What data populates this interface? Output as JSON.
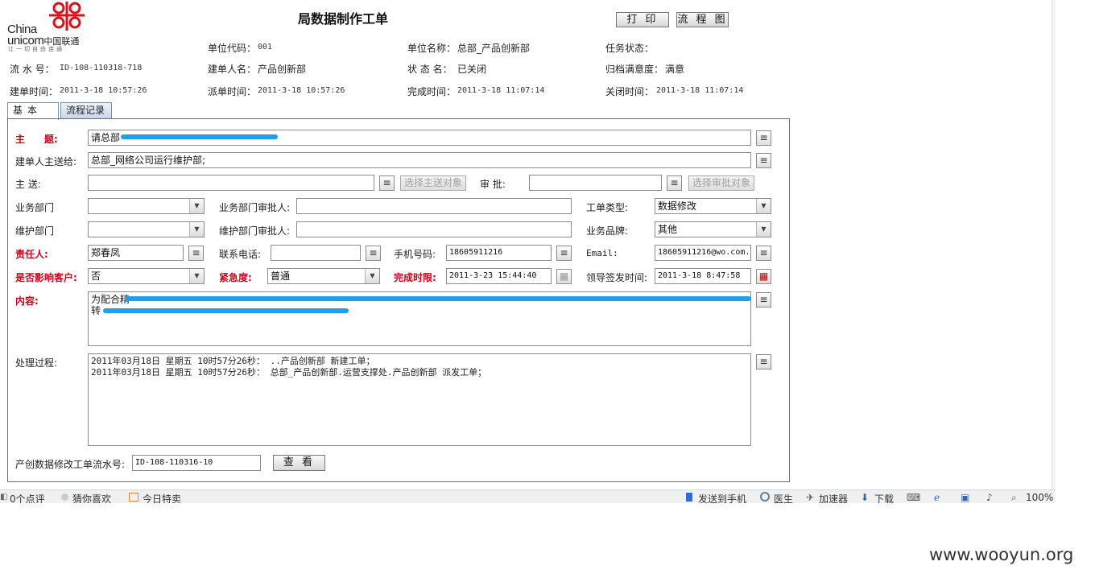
{
  "logo": {
    "en_line1": "China",
    "en_line2": "unicom",
    "cn_name": "中国联通",
    "slogan": "让一切自由连通"
  },
  "title": "局数据制作工单",
  "buttons": {
    "print": "打 印",
    "flowchart": "流 程 图",
    "view": "查 看",
    "select_cc": "选择主送对象",
    "select_approve": "选择审批对象"
  },
  "header": {
    "unit_code_label": "单位代码：",
    "unit_code": "001",
    "unit_name_label": "单位名称：",
    "unit_name": "总部_产品创新部",
    "task_status_label": "任务状态：",
    "task_status": "",
    "serial_label": "流 水 号：",
    "serial": "ID-108-110318-718",
    "creator_label": "建单人名：",
    "creator": "产品创新部",
    "status_label": "状 态 名：",
    "status": "已关闭",
    "satisfaction_label": "归档满意度：",
    "satisfaction": "满意",
    "created_label": "建单时间：",
    "created": "2011-3-18 10:57:26",
    "dispatched_label": "派单时间：",
    "dispatched": "2011-3-18 10:57:26",
    "completed_label": "完成时间：",
    "completed": "2011-3-18 11:07:14",
    "closed_label": "关闭时间：",
    "closed": "2011-3-18 11:07:14"
  },
  "tabs": [
    {
      "label": "基本"
    },
    {
      "label": "流程记录"
    }
  ],
  "form": {
    "subject_label": "主　　题:",
    "subject": "请总部",
    "main_recipient_label": "建单人主送给:",
    "main_recipient": "总部_网络公司运行维护部;",
    "cc_label": "主 送:",
    "cc": "",
    "approve_label": "审 批:",
    "approve": "",
    "biz_dept_label": "业务部门",
    "biz_dept": "",
    "biz_approver_label": "业务部门审批人:",
    "biz_approver": "",
    "order_type_label": "工单类型:",
    "order_type": "数据修改",
    "maint_dept_label": "维护部门",
    "maint_dept": "",
    "maint_approver_label": "维护部门审批人:",
    "maint_approver": "",
    "brand_label": "业务品牌:",
    "brand": "其他",
    "owner_label": "责任人:",
    "owner": "郑春凤",
    "phone_label": "联系电话:",
    "phone": "",
    "mobile_label": "手机号码:",
    "mobile": "18605911216",
    "email_label": "Email:",
    "email": "18605911216@wo.com.cn",
    "affect_label": "是否影响客户:",
    "affect": "否",
    "urgency_label": "紧急度:",
    "urgency": "普通",
    "deadline_label": "完成时限:",
    "deadline": "2011-3-23 15:44:40",
    "sign_label": "领导签发时间:",
    "sign_time": "2011-3-18 8:47:58",
    "content_label": "内容:",
    "content_line1": "为配合精",
    "content_line2": "转",
    "process_label": "处理过程:",
    "process_lines": [
      "2011年03月18日 星期五 10时57分26秒： ..产品创新部 新建工单；",
      "2011年03月18日 星期五 10时57分26秒： 总部_产品创新部.运营支撑处.产品创新部 派发工单；"
    ],
    "ref_label": "产创数据修改工单流水号:",
    "ref": "ID-108-110316-10"
  },
  "statusbar": {
    "comments": "0个点评",
    "guess": "猜你喜欢",
    "today": "今日特卖",
    "send_phone": "发送到手机",
    "doctor": "医生",
    "accelerator": "加速器",
    "download": "下载",
    "zoom": "100%"
  },
  "watermark": "www.wooyun.org"
}
